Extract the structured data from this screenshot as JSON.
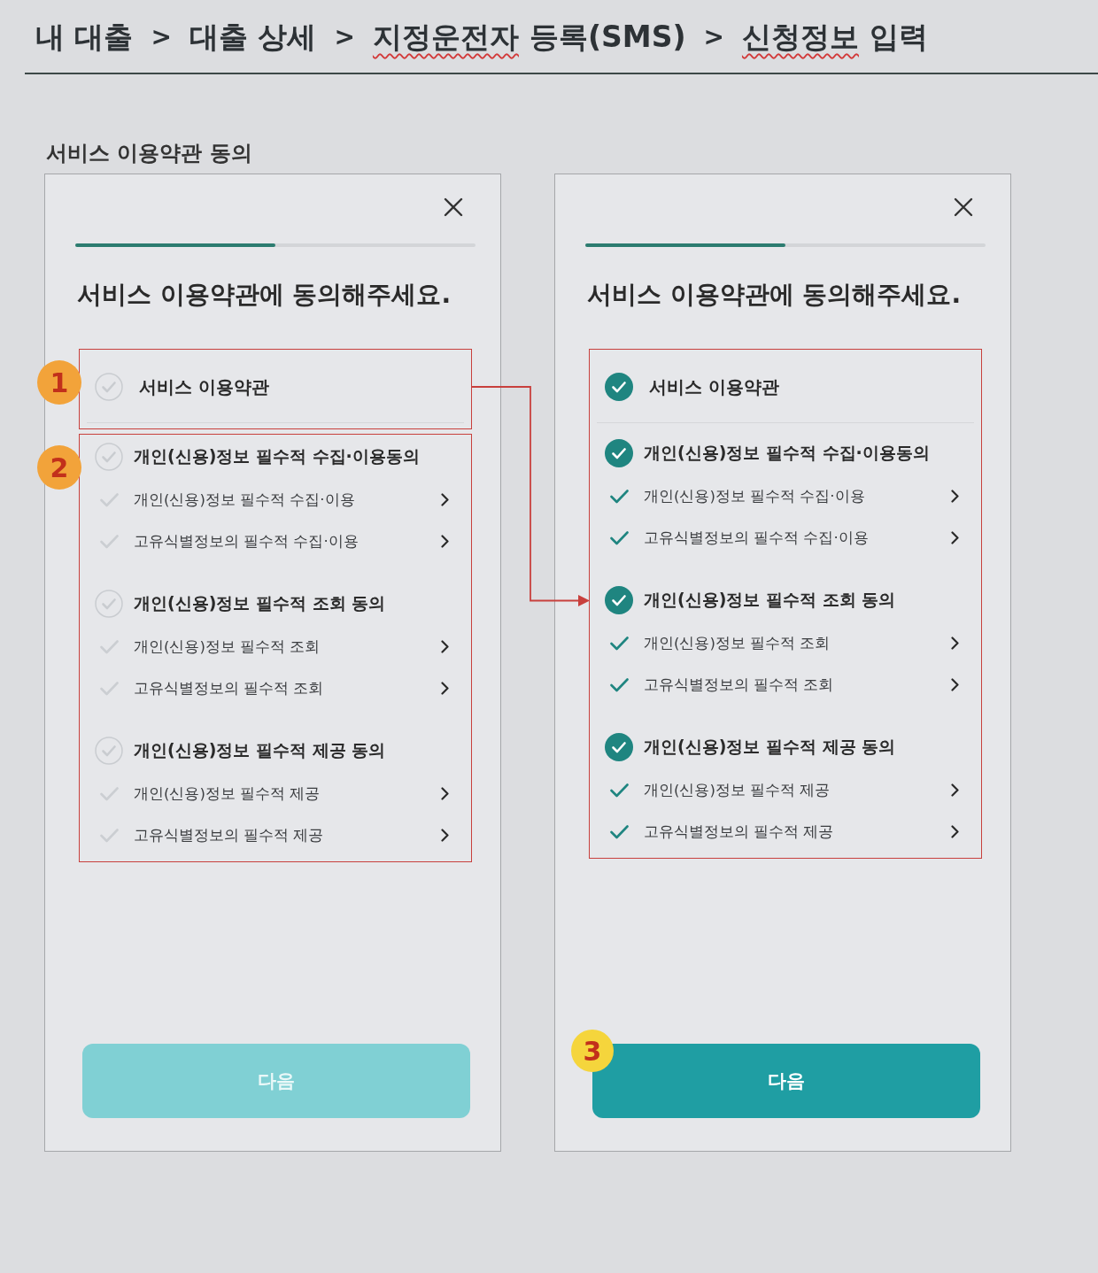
{
  "breadcrumb": [
    {
      "kind": "text",
      "text": "내 대출",
      "misspelled": false
    },
    {
      "kind": "separator",
      "text": ">",
      "misspelled": false
    },
    {
      "kind": "text",
      "text": "대출 상세",
      "misspelled": false
    },
    {
      "kind": "separator",
      "text": ">",
      "misspelled": false
    },
    {
      "kind": "text",
      "text": "지정운전자",
      "misspelled": true
    },
    {
      "kind": "text",
      "text": "등록(SMS)",
      "misspelled": false
    },
    {
      "kind": "separator",
      "text": ">",
      "misspelled": false
    },
    {
      "kind": "text",
      "text": "신청정보",
      "misspelled": true
    },
    {
      "kind": "text",
      "text": "입력",
      "misspelled": false
    }
  ],
  "section_title": "서비스 이용약관 동의",
  "screens": [
    {
      "progress": {
        "level": 0.5
      },
      "heading": "서비스 이용약관에 동의해주세요.",
      "blocks": [
        {
          "badge": {
            "text": "1",
            "color": "#f2a33a"
          },
          "rows": [
            {
              "kind": "header",
              "label": "서비스 이용약관",
              "checked": false
            }
          ]
        },
        {
          "badge": {
            "text": "2",
            "color": "#f2a33a"
          },
          "rows": [
            {
              "kind": "group",
              "label": "개인(신용)정보 필수적 수집·이용동의",
              "checked": false
            },
            {
              "kind": "item",
              "label": "개인(신용)정보 필수적 수집·이용",
              "checked": false
            },
            {
              "kind": "item",
              "label": "고유식별정보의 필수적 수집·이용",
              "checked": false
            },
            {
              "kind": "group",
              "label": "개인(신용)정보 필수적 조회 동의",
              "checked": false
            },
            {
              "kind": "item",
              "label": "개인(신용)정보 필수적 조회",
              "checked": false
            },
            {
              "kind": "item",
              "label": "고유식별정보의 필수적 조회",
              "checked": false
            },
            {
              "kind": "group",
              "label": "개인(신용)정보 필수적 제공 동의",
              "checked": false
            },
            {
              "kind": "item",
              "label": "개인(신용)정보 필수적 제공",
              "checked": false
            },
            {
              "kind": "item",
              "label": "고유식별정보의 필수적 제공",
              "checked": false
            }
          ]
        }
      ],
      "button": {
        "label": "다음",
        "disabled": true
      }
    },
    {
      "progress": {
        "level": 0.5
      },
      "heading": "서비스 이용약관에 동의해주세요.",
      "blocks": [
        {
          "rows": [
            {
              "kind": "header",
              "label": "서비스 이용약관",
              "checked": true
            },
            {
              "kind": "group",
              "label": "개인(신용)정보 필수적 수집·이용동의",
              "checked": true
            },
            {
              "kind": "item",
              "label": "개인(신용)정보 필수적 수집·이용",
              "checked": true
            },
            {
              "kind": "item",
              "label": "고유식별정보의 필수적 수집·이용",
              "checked": true
            },
            {
              "kind": "group",
              "label": "개인(신용)정보 필수적 조회 동의",
              "checked": true
            },
            {
              "kind": "item",
              "label": "개인(신용)정보 필수적 조회",
              "checked": true
            },
            {
              "kind": "item",
              "label": "고유식별정보의 필수적 조회",
              "checked": true
            },
            {
              "kind": "group",
              "label": "개인(신용)정보 필수적 제공 동의",
              "checked": true
            },
            {
              "kind": "item",
              "label": "개인(신용)정보 필수적 제공",
              "checked": true
            },
            {
              "kind": "item",
              "label": "고유식별정보의 필수적 제공",
              "checked": true
            }
          ]
        }
      ],
      "button": {
        "label": "다음",
        "disabled": false,
        "badge": {
          "text": "3",
          "color": "#f5d53c"
        }
      }
    }
  ]
}
